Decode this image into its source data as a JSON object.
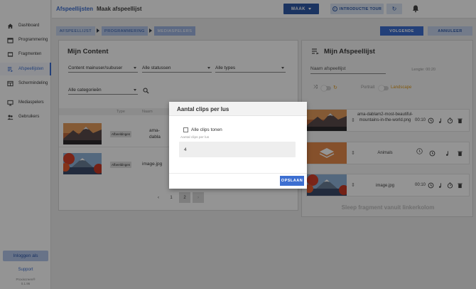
{
  "sidebar": {
    "items": [
      {
        "label": "Dashboard",
        "icon": "home-icon"
      },
      {
        "label": "Programmering",
        "icon": "calendar-icon"
      },
      {
        "label": "Fragmenten",
        "icon": "film-icon"
      },
      {
        "label": "Afspeellijsten",
        "icon": "playlist-icon",
        "active": true
      },
      {
        "label": "Schermindeling",
        "icon": "layout-icon"
      },
      {
        "label": "Mediaspelers",
        "icon": "monitor-icon"
      },
      {
        "label": "Gebruikers",
        "icon": "users-icon"
      }
    ],
    "login_label": "Inloggen als",
    "support_label": "Support",
    "copyright_line1": "Proxiscreen®",
    "copyright_line2": "0.1.96"
  },
  "topbar": {
    "breadcrumb_root": "Afspeellijsten",
    "breadcrumb_sep": "›",
    "breadcrumb_current": "Maak afspeellijst",
    "maak_label": "MAAK",
    "tour_label": "INTRODUCTIE TOUR"
  },
  "steps": {
    "items": [
      "AFSPEELLIJST",
      "PROGRAMMERING",
      "MEDIASPELERS"
    ],
    "next_label": "VOLGENDE",
    "cancel_label": "ANNULEER"
  },
  "content_panel": {
    "title": "Mijn Content",
    "filter_owner": "Content mainuser/subuser",
    "filter_status": "Alle statussen",
    "filter_type": "Alle types",
    "filter_category": "Alle categorieën",
    "col_type": "Type",
    "col_name": "Naam",
    "rows": [
      {
        "type": "Afbeeldingen",
        "name": "ama-dabla mountain"
      },
      {
        "type": "Afbeeldingen",
        "name": "image.jpg"
      }
    ],
    "pages": [
      "‹",
      "1",
      "2",
      "›"
    ]
  },
  "playlist_panel": {
    "title": "Mijn Afspeellijst",
    "name_placeholder": "Naam afspeellijst",
    "length_label": "Lengte: 00:20",
    "portrait_label": "Portrait",
    "landscape_label": "Landscape",
    "items": [
      {
        "name": "ama-dablam2-most-beautiful-mountains-in-the-world.png",
        "time": "00:10"
      },
      {
        "name": "Animals",
        "time": ""
      },
      {
        "name": "image.jpg",
        "time": "00:10"
      }
    ],
    "drop_hint": "Sleep fragment vanuit linkerkolom"
  },
  "modal": {
    "title": "Aantal clips per lus",
    "checkbox_label": "Alle clips tonen",
    "field_label": "Aantal clips per lus",
    "field_value": "4",
    "save_label": "OPSLAAN"
  },
  "colors": {
    "accent": "#3d6fd1",
    "dark_accent": "#2f5aa8",
    "landscape": "#e09a1a"
  }
}
